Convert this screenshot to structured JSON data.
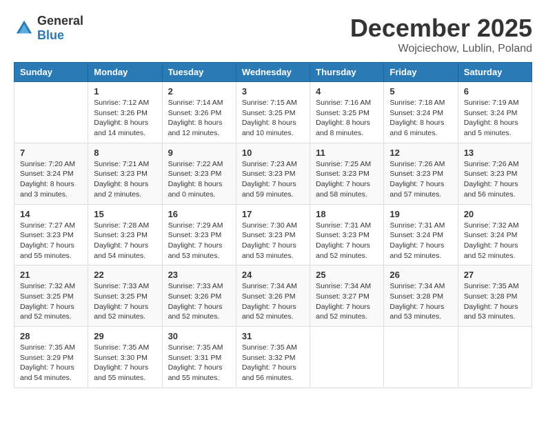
{
  "logo": {
    "general": "General",
    "blue": "Blue"
  },
  "header": {
    "month": "December 2025",
    "location": "Wojciechow, Lublin, Poland"
  },
  "weekdays": [
    "Sunday",
    "Monday",
    "Tuesday",
    "Wednesday",
    "Thursday",
    "Friday",
    "Saturday"
  ],
  "weeks": [
    [
      {
        "day": "",
        "info": ""
      },
      {
        "day": "1",
        "info": "Sunrise: 7:12 AM\nSunset: 3:26 PM\nDaylight: 8 hours\nand 14 minutes."
      },
      {
        "day": "2",
        "info": "Sunrise: 7:14 AM\nSunset: 3:26 PM\nDaylight: 8 hours\nand 12 minutes."
      },
      {
        "day": "3",
        "info": "Sunrise: 7:15 AM\nSunset: 3:25 PM\nDaylight: 8 hours\nand 10 minutes."
      },
      {
        "day": "4",
        "info": "Sunrise: 7:16 AM\nSunset: 3:25 PM\nDaylight: 8 hours\nand 8 minutes."
      },
      {
        "day": "5",
        "info": "Sunrise: 7:18 AM\nSunset: 3:24 PM\nDaylight: 8 hours\nand 6 minutes."
      },
      {
        "day": "6",
        "info": "Sunrise: 7:19 AM\nSunset: 3:24 PM\nDaylight: 8 hours\nand 5 minutes."
      }
    ],
    [
      {
        "day": "7",
        "info": "Sunrise: 7:20 AM\nSunset: 3:24 PM\nDaylight: 8 hours\nand 3 minutes."
      },
      {
        "day": "8",
        "info": "Sunrise: 7:21 AM\nSunset: 3:23 PM\nDaylight: 8 hours\nand 2 minutes."
      },
      {
        "day": "9",
        "info": "Sunrise: 7:22 AM\nSunset: 3:23 PM\nDaylight: 8 hours\nand 0 minutes."
      },
      {
        "day": "10",
        "info": "Sunrise: 7:23 AM\nSunset: 3:23 PM\nDaylight: 7 hours\nand 59 minutes."
      },
      {
        "day": "11",
        "info": "Sunrise: 7:25 AM\nSunset: 3:23 PM\nDaylight: 7 hours\nand 58 minutes."
      },
      {
        "day": "12",
        "info": "Sunrise: 7:26 AM\nSunset: 3:23 PM\nDaylight: 7 hours\nand 57 minutes."
      },
      {
        "day": "13",
        "info": "Sunrise: 7:26 AM\nSunset: 3:23 PM\nDaylight: 7 hours\nand 56 minutes."
      }
    ],
    [
      {
        "day": "14",
        "info": "Sunrise: 7:27 AM\nSunset: 3:23 PM\nDaylight: 7 hours\nand 55 minutes."
      },
      {
        "day": "15",
        "info": "Sunrise: 7:28 AM\nSunset: 3:23 PM\nDaylight: 7 hours\nand 54 minutes."
      },
      {
        "day": "16",
        "info": "Sunrise: 7:29 AM\nSunset: 3:23 PM\nDaylight: 7 hours\nand 53 minutes."
      },
      {
        "day": "17",
        "info": "Sunrise: 7:30 AM\nSunset: 3:23 PM\nDaylight: 7 hours\nand 53 minutes."
      },
      {
        "day": "18",
        "info": "Sunrise: 7:31 AM\nSunset: 3:23 PM\nDaylight: 7 hours\nand 52 minutes."
      },
      {
        "day": "19",
        "info": "Sunrise: 7:31 AM\nSunset: 3:24 PM\nDaylight: 7 hours\nand 52 minutes."
      },
      {
        "day": "20",
        "info": "Sunrise: 7:32 AM\nSunset: 3:24 PM\nDaylight: 7 hours\nand 52 minutes."
      }
    ],
    [
      {
        "day": "21",
        "info": "Sunrise: 7:32 AM\nSunset: 3:25 PM\nDaylight: 7 hours\nand 52 minutes."
      },
      {
        "day": "22",
        "info": "Sunrise: 7:33 AM\nSunset: 3:25 PM\nDaylight: 7 hours\nand 52 minutes."
      },
      {
        "day": "23",
        "info": "Sunrise: 7:33 AM\nSunset: 3:26 PM\nDaylight: 7 hours\nand 52 minutes."
      },
      {
        "day": "24",
        "info": "Sunrise: 7:34 AM\nSunset: 3:26 PM\nDaylight: 7 hours\nand 52 minutes."
      },
      {
        "day": "25",
        "info": "Sunrise: 7:34 AM\nSunset: 3:27 PM\nDaylight: 7 hours\nand 52 minutes."
      },
      {
        "day": "26",
        "info": "Sunrise: 7:34 AM\nSunset: 3:28 PM\nDaylight: 7 hours\nand 53 minutes."
      },
      {
        "day": "27",
        "info": "Sunrise: 7:35 AM\nSunset: 3:28 PM\nDaylight: 7 hours\nand 53 minutes."
      }
    ],
    [
      {
        "day": "28",
        "info": "Sunrise: 7:35 AM\nSunset: 3:29 PM\nDaylight: 7 hours\nand 54 minutes."
      },
      {
        "day": "29",
        "info": "Sunrise: 7:35 AM\nSunset: 3:30 PM\nDaylight: 7 hours\nand 55 minutes."
      },
      {
        "day": "30",
        "info": "Sunrise: 7:35 AM\nSunset: 3:31 PM\nDaylight: 7 hours\nand 55 minutes."
      },
      {
        "day": "31",
        "info": "Sunrise: 7:35 AM\nSunset: 3:32 PM\nDaylight: 7 hours\nand 56 minutes."
      },
      {
        "day": "",
        "info": ""
      },
      {
        "day": "",
        "info": ""
      },
      {
        "day": "",
        "info": ""
      }
    ]
  ]
}
